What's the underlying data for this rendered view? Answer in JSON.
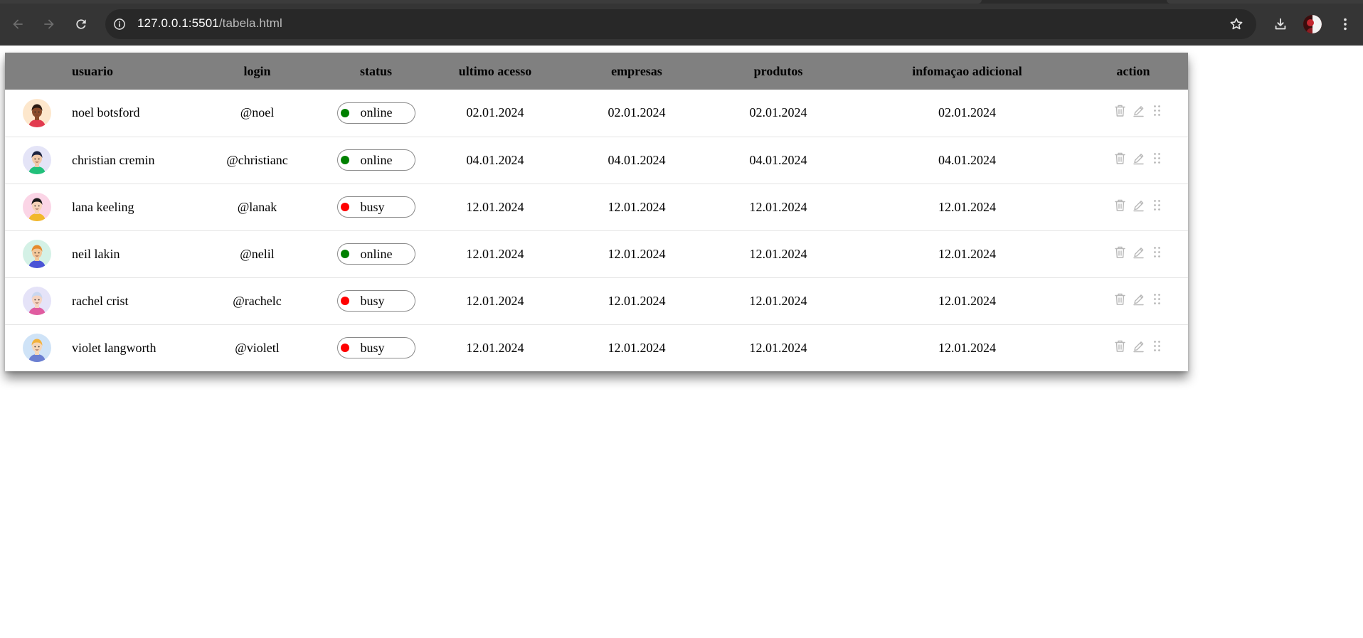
{
  "browser": {
    "url_host": "127.0.0.1:5501",
    "url_path": "/tabela.html"
  },
  "table": {
    "headers": [
      "usuario",
      "login",
      "status",
      "ultimo acesso",
      "empresas",
      "produtos",
      "infomaçao adicional",
      "action"
    ],
    "rows": [
      {
        "name": "noel botsford",
        "login": "@noel",
        "status": "online",
        "ultimo_acesso": "02.01.2024",
        "empresas": "02.01.2024",
        "produtos": "02.01.2024",
        "info": "02.01.2024",
        "avatar": {
          "bg": "#fde7cc",
          "skin": "#8a4b2a",
          "hair": "#2a1a12",
          "shirt": "#e23b4f"
        }
      },
      {
        "name": "christian cremin",
        "login": "@christianc",
        "status": "online",
        "ultimo_acesso": "04.01.2024",
        "empresas": "04.01.2024",
        "produtos": "04.01.2024",
        "info": "04.01.2024",
        "avatar": {
          "bg": "#e4e4f7",
          "skin": "#f2c9a8",
          "hair": "#1c2340",
          "shirt": "#22c07a"
        }
      },
      {
        "name": "lana keeling",
        "login": "@lanak",
        "status": "busy",
        "ultimo_acesso": "12.01.2024",
        "empresas": "12.01.2024",
        "produtos": "12.01.2024",
        "info": "12.01.2024",
        "avatar": {
          "bg": "#fbd5e6",
          "skin": "#f5d3b8",
          "hair": "#1a1a1a",
          "shirt": "#f1b82c"
        }
      },
      {
        "name": "neil lakin",
        "login": "@nelil",
        "status": "online",
        "ultimo_acesso": "12.01.2024",
        "empresas": "12.01.2024",
        "produtos": "12.01.2024",
        "info": "12.01.2024",
        "avatar": {
          "bg": "#d4f1e6",
          "skin": "#f2c79a",
          "hair": "#e58a2c",
          "shirt": "#4a54d6"
        }
      },
      {
        "name": "rachel crist",
        "login": "@rachelc",
        "status": "busy",
        "ultimo_acesso": "12.01.2024",
        "empresas": "12.01.2024",
        "produtos": "12.01.2024",
        "info": "12.01.2024",
        "avatar": {
          "bg": "#e5e3f8",
          "skin": "#f5d3c0",
          "hair": "#c9d7f0",
          "shirt": "#e05ca0"
        }
      },
      {
        "name": "violet langworth",
        "login": "@violetl",
        "status": "busy",
        "ultimo_acesso": "12.01.2024",
        "empresas": "12.01.2024",
        "produtos": "12.01.2024",
        "info": "12.01.2024",
        "avatar": {
          "bg": "#cfe3f7",
          "skin": "#f5d6b8",
          "hair": "#f2b23c",
          "shirt": "#6b7fd1"
        }
      }
    ]
  },
  "colors": {
    "header_bg": "#808080",
    "online": "#008000",
    "busy": "#ff0000",
    "action_icon": "#b8b8b8"
  },
  "icons": {
    "back": "arrow-left-icon",
    "forward": "arrow-right-icon",
    "reload": "reload-icon",
    "site_info": "info-icon",
    "bookmark": "star-icon",
    "download": "download-icon",
    "menu": "kebab-menu-icon",
    "row_actions": [
      "trash-icon",
      "pencil-icon",
      "drag-handle-icon"
    ]
  }
}
